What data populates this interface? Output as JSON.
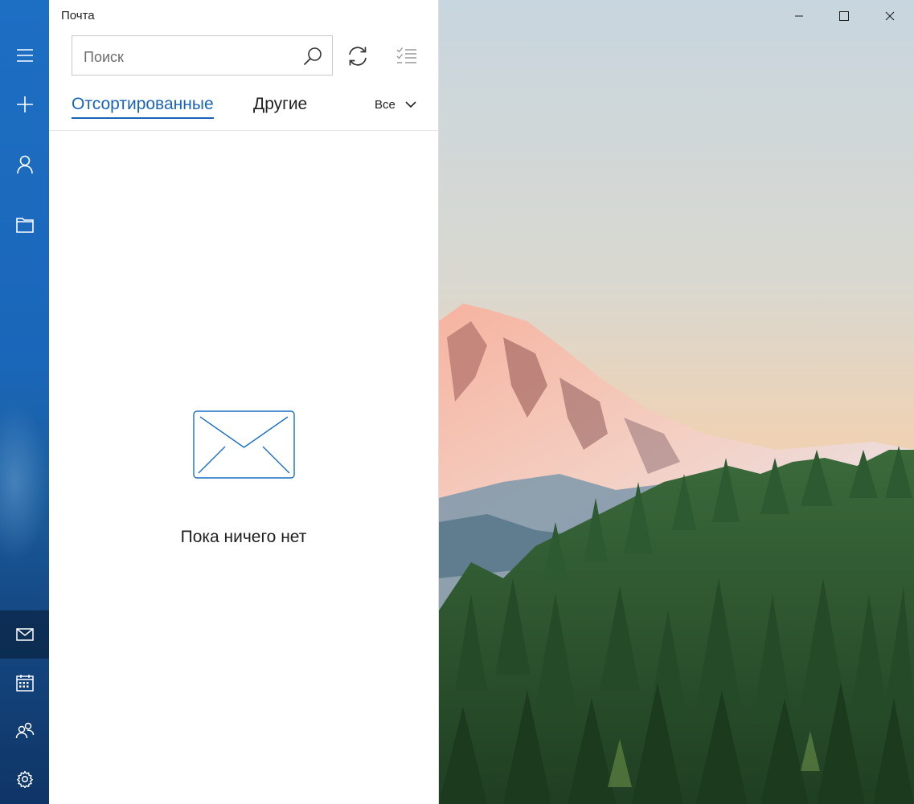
{
  "app": {
    "title": "Почта"
  },
  "search": {
    "placeholder": "Поиск"
  },
  "tabs": {
    "focused": "Отсортированные",
    "other": "Другие"
  },
  "filter": {
    "label": "Все"
  },
  "empty_state": {
    "message": "Пока ничего нет"
  },
  "rail": {
    "items": [
      "menu-icon",
      "new-mail-icon",
      "account-icon",
      "folder-icon"
    ],
    "bottom": [
      "mail-icon",
      "calendar-icon",
      "people-icon",
      "settings-icon"
    ]
  },
  "colors": {
    "accent": "#1a64b8",
    "rail": "#1d6fc4"
  }
}
